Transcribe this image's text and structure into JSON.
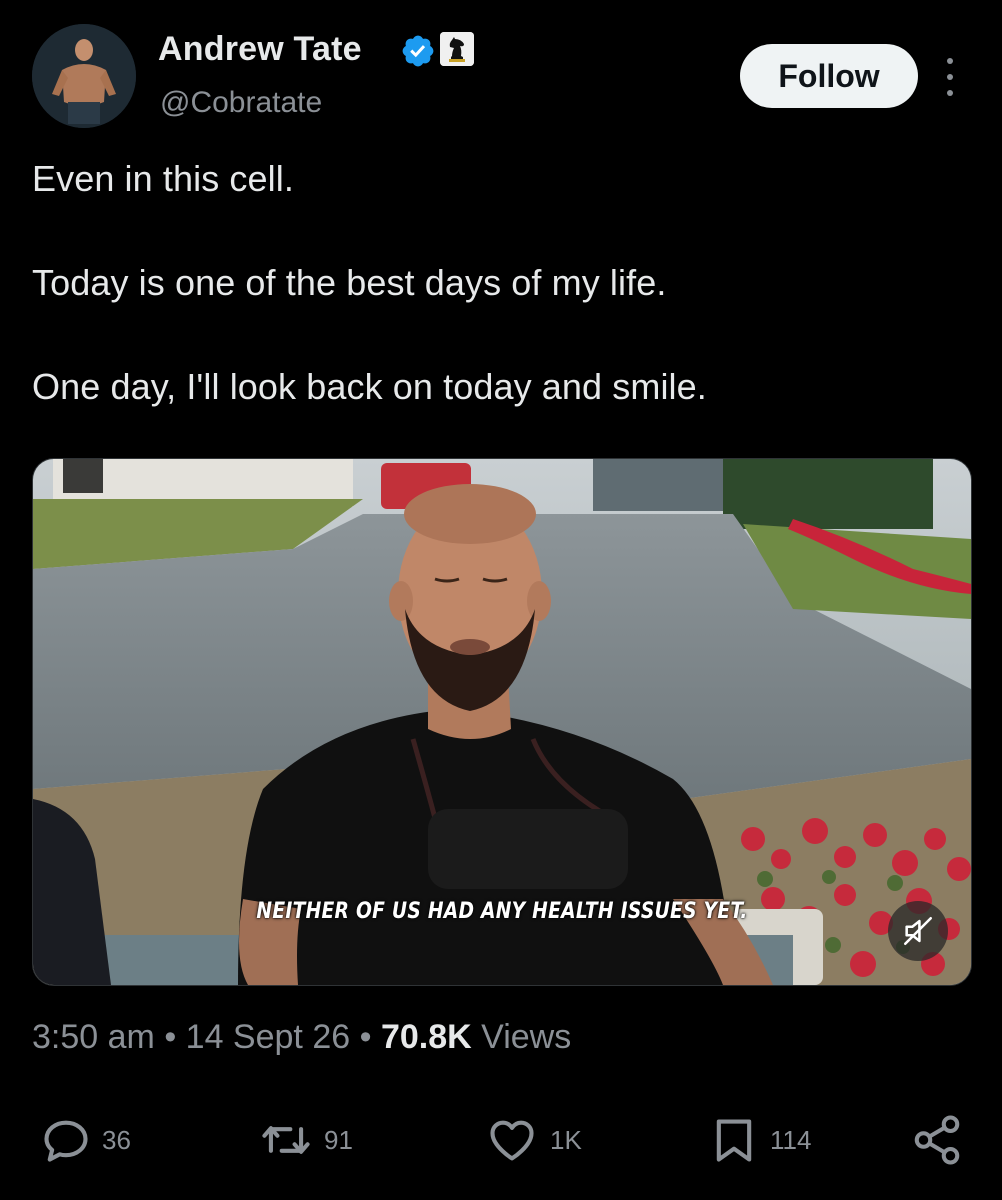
{
  "author": {
    "name": "Andrew Tate",
    "handle": "@Cobratate",
    "verified_icon": "verified-badge-icon",
    "affiliate_icon": "chess-knight-icon"
  },
  "header": {
    "follow_label": "Follow",
    "more_icon": "more-vertical-icon"
  },
  "tweet": {
    "lines": [
      "Even in this cell.",
      "Today is one of the best days of my life.",
      "One day, I'll look back on today and smile."
    ]
  },
  "media": {
    "caption": "NEITHER OF US HAD ANY HEALTH ISSUES YET.",
    "mute_icon": "muted-speaker-icon"
  },
  "meta": {
    "time": "3:50 am",
    "separator": "•",
    "date": "14 Sept 26",
    "views_count": "70.8K",
    "views_label": "Views"
  },
  "actions": {
    "replies": "36",
    "reposts": "91",
    "likes": "1K",
    "bookmarks": "114"
  },
  "colors": {
    "background": "#000000",
    "text": "#e7e9ea",
    "muted": "#8b9096",
    "verified": "#1d9bf0",
    "follow_bg": "#eff3f4"
  }
}
